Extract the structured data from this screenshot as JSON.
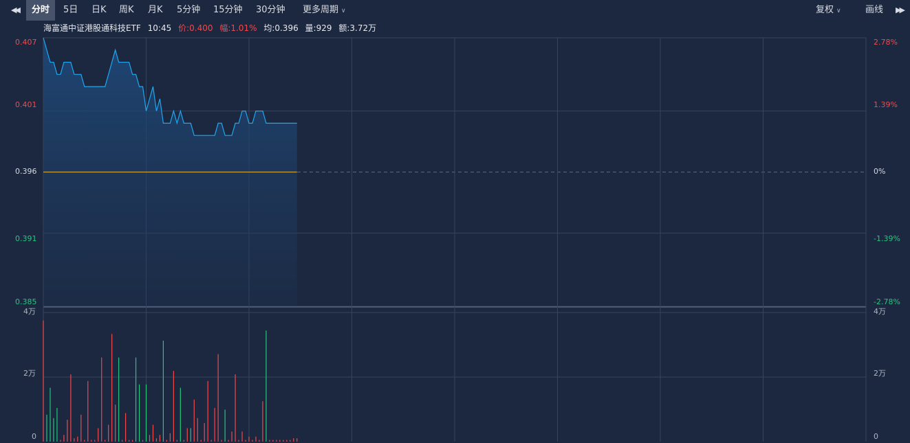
{
  "toolbar": {
    "prev_icon": "double-chevron-left-icon",
    "tabs": [
      {
        "label": "分时",
        "active": true
      },
      {
        "label": "5日"
      },
      {
        "label": "日K"
      },
      {
        "label": "周K"
      },
      {
        "label": "月K"
      },
      {
        "label": "5分钟"
      },
      {
        "label": "15分钟"
      },
      {
        "label": "30分钟"
      }
    ],
    "more_periods": "更多周期",
    "adjust": "复权",
    "draw": "画线",
    "next_icon": "double-chevron-right-icon"
  },
  "info": {
    "name": "海富通中证港股通科技ETF",
    "time": "10:45",
    "price_label": "价:0.400",
    "change_label": "幅:1.01%",
    "avg_label": "均:0.396",
    "volume_label": "量:929",
    "amount_label": "额:3.72万"
  },
  "colors": {
    "background": "#1c2840",
    "up": "#f0494b",
    "down": "#24c77d",
    "price_line": "#1ea7f0",
    "avg_line": "#c9a23a",
    "grid": "#34435e"
  },
  "chart_data": {
    "type": "line",
    "title": "海富通中证港股通科技ETF",
    "price_ylim": [
      0.385,
      0.407
    ],
    "prev_close": 0.396,
    "price_ticks_left": [
      "0.407",
      "0.401",
      "0.396",
      "0.391",
      "0.385"
    ],
    "price_ticks_right": [
      "2.78%",
      "1.39%",
      "0%",
      "-1.39%",
      "-2.78%"
    ],
    "volume_ticks_left": [
      "4万",
      "2万",
      "0"
    ],
    "volume_ticks_right": [
      "4万",
      "2万",
      "0"
    ],
    "volume_ylim": [
      0,
      40000
    ],
    "minutes_total": 240,
    "price": [
      0.407,
      0.406,
      0.405,
      0.405,
      0.404,
      0.404,
      0.405,
      0.405,
      0.405,
      0.404,
      0.404,
      0.404,
      0.403,
      0.403,
      0.403,
      0.403,
      0.403,
      0.403,
      0.403,
      0.404,
      0.405,
      0.406,
      0.405,
      0.405,
      0.405,
      0.405,
      0.404,
      0.404,
      0.403,
      0.403,
      0.401,
      0.402,
      0.403,
      0.401,
      0.402,
      0.4,
      0.4,
      0.4,
      0.401,
      0.4,
      0.401,
      0.4,
      0.4,
      0.4,
      0.399,
      0.399,
      0.399,
      0.399,
      0.399,
      0.399,
      0.399,
      0.4,
      0.4,
      0.399,
      0.399,
      0.399,
      0.4,
      0.4,
      0.401,
      0.401,
      0.4,
      0.4,
      0.401,
      0.401,
      0.401,
      0.4,
      0.4,
      0.4,
      0.4,
      0.4,
      0.4,
      0.4,
      0.4,
      0.4,
      0.4
    ],
    "avg": [
      0.396,
      0.396,
      0.396,
      0.396,
      0.396,
      0.396,
      0.396,
      0.396,
      0.396,
      0.396,
      0.396,
      0.396,
      0.396,
      0.396,
      0.396,
      0.396,
      0.396,
      0.396,
      0.396,
      0.396,
      0.396,
      0.396,
      0.396,
      0.396,
      0.396,
      0.396,
      0.396,
      0.396,
      0.396,
      0.396,
      0.396,
      0.396,
      0.396,
      0.396,
      0.396,
      0.396,
      0.396,
      0.396,
      0.396,
      0.396,
      0.396,
      0.396,
      0.396,
      0.396,
      0.396,
      0.396,
      0.396,
      0.396,
      0.396,
      0.396,
      0.396,
      0.396,
      0.396,
      0.396,
      0.396,
      0.396,
      0.396,
      0.396,
      0.396,
      0.396,
      0.396,
      0.396,
      0.396,
      0.396,
      0.396,
      0.396,
      0.396,
      0.396,
      0.396,
      0.396,
      0.396,
      0.396,
      0.396,
      0.396,
      0.396
    ],
    "volume": [
      {
        "v": 36000,
        "d": "up"
      },
      {
        "v": 8000,
        "d": "down"
      },
      {
        "v": 16000,
        "d": "down"
      },
      {
        "v": 7000,
        "d": "down"
      },
      {
        "v": 10000,
        "d": "down"
      },
      {
        "v": 500,
        "d": "up"
      },
      {
        "v": 2000,
        "d": "up"
      },
      {
        "v": 6500,
        "d": "up"
      },
      {
        "v": 20000,
        "d": "up"
      },
      {
        "v": 1000,
        "d": "up"
      },
      {
        "v": 1500,
        "d": "up"
      },
      {
        "v": 8000,
        "d": "up"
      },
      {
        "v": 500,
        "d": "up"
      },
      {
        "v": 18000,
        "d": "up"
      },
      {
        "v": 500,
        "d": "up"
      },
      {
        "v": 500,
        "d": "up"
      },
      {
        "v": 4000,
        "d": "up"
      },
      {
        "v": 25000,
        "d": "up"
      },
      {
        "v": 500,
        "d": "up"
      },
      {
        "v": 5000,
        "d": "up"
      },
      {
        "v": 32000,
        "d": "up"
      },
      {
        "v": 11000,
        "d": "up"
      },
      {
        "v": 25000,
        "d": "down"
      },
      {
        "v": 500,
        "d": "up"
      },
      {
        "v": 8500,
        "d": "up"
      },
      {
        "v": 500,
        "d": "up"
      },
      {
        "v": 500,
        "d": "up"
      },
      {
        "v": 25000,
        "d": "down"
      },
      {
        "v": 17000,
        "d": "down"
      },
      {
        "v": 500,
        "d": "up"
      },
      {
        "v": 17000,
        "d": "down"
      },
      {
        "v": 2000,
        "d": "up"
      },
      {
        "v": 5000,
        "d": "up"
      },
      {
        "v": 1000,
        "d": "up"
      },
      {
        "v": 2000,
        "d": "up"
      },
      {
        "v": 30000,
        "d": "down"
      },
      {
        "v": 500,
        "d": "up"
      },
      {
        "v": 2500,
        "d": "up"
      },
      {
        "v": 21000,
        "d": "up"
      },
      {
        "v": 500,
        "d": "up"
      },
      {
        "v": 16000,
        "d": "down"
      },
      {
        "v": 500,
        "d": "up"
      },
      {
        "v": 4000,
        "d": "up"
      },
      {
        "v": 4000,
        "d": "down"
      },
      {
        "v": 12500,
        "d": "up"
      },
      {
        "v": 7000,
        "d": "up"
      },
      {
        "v": 500,
        "d": "up"
      },
      {
        "v": 5500,
        "d": "up"
      },
      {
        "v": 18000,
        "d": "up"
      },
      {
        "v": 500,
        "d": "up"
      },
      {
        "v": 10000,
        "d": "up"
      },
      {
        "v": 26000,
        "d": "up"
      },
      {
        "v": 500,
        "d": "up"
      },
      {
        "v": 9500,
        "d": "down"
      },
      {
        "v": 500,
        "d": "up"
      },
      {
        "v": 3000,
        "d": "up"
      },
      {
        "v": 20000,
        "d": "up"
      },
      {
        "v": 500,
        "d": "up"
      },
      {
        "v": 3000,
        "d": "up"
      },
      {
        "v": 500,
        "d": "up"
      },
      {
        "v": 1500,
        "d": "up"
      },
      {
        "v": 500,
        "d": "up"
      },
      {
        "v": 1500,
        "d": "up"
      },
      {
        "v": 500,
        "d": "up"
      },
      {
        "v": 12000,
        "d": "up"
      },
      {
        "v": 33000,
        "d": "down"
      },
      {
        "v": 500,
        "d": "up"
      },
      {
        "v": 500,
        "d": "up"
      },
      {
        "v": 500,
        "d": "up"
      },
      {
        "v": 500,
        "d": "up"
      },
      {
        "v": 500,
        "d": "up"
      },
      {
        "v": 500,
        "d": "up"
      },
      {
        "v": 500,
        "d": "up"
      },
      {
        "v": 1000,
        "d": "up"
      },
      {
        "v": 1000,
        "d": "up"
      }
    ]
  }
}
